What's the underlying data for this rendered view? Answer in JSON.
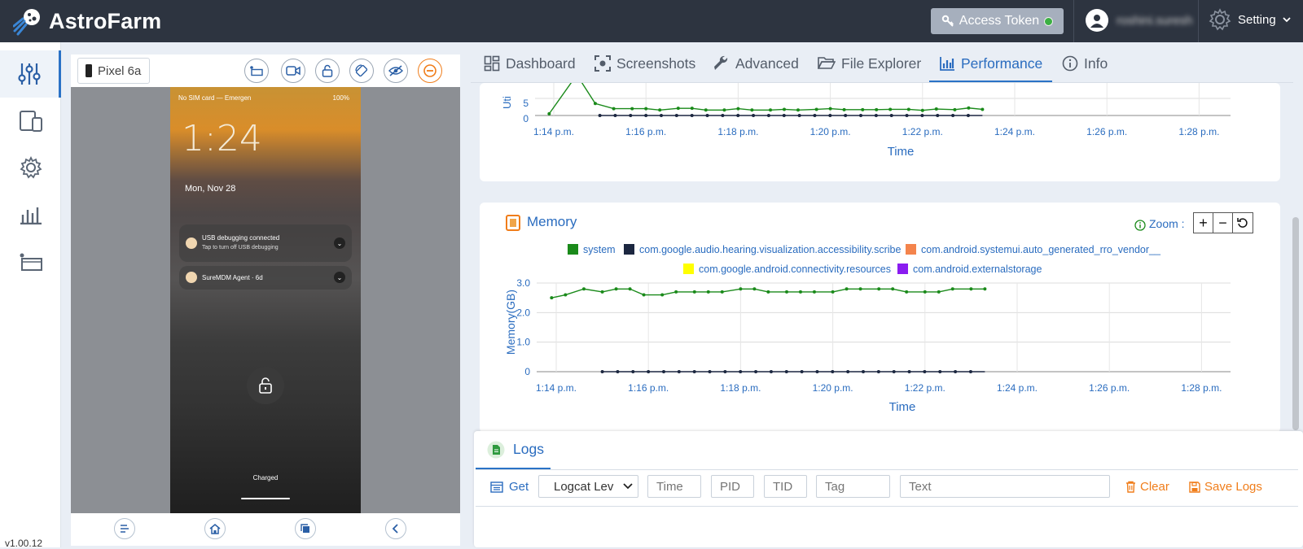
{
  "header": {
    "app_name": "AstroFarm",
    "access_token_label": "Access Token",
    "username": "roshini.suresh",
    "setting_label": "Setting"
  },
  "version": "v1.00.12",
  "device": {
    "name": "Pixel 6a",
    "screen": {
      "status_left": "No SIM card — Emergen",
      "status_right": "100%",
      "clock": "1:24",
      "date": "Mon, Nov 28",
      "notifications": [
        {
          "title": "USB debugging connected",
          "subtitle": "Tap to turn off USB debugging"
        },
        {
          "title": "SureMDM Agent · 6d",
          "subtitle": ""
        }
      ],
      "charged": "Charged"
    }
  },
  "tabs": [
    {
      "label": "Dashboard",
      "icon": "dashboard-icon",
      "active": false
    },
    {
      "label": "Screenshots",
      "icon": "screenshot-icon",
      "active": false
    },
    {
      "label": "Advanced",
      "icon": "wrench-icon",
      "active": false
    },
    {
      "label": "File Explorer",
      "icon": "folder-icon",
      "active": false
    },
    {
      "label": "Performance",
      "icon": "bar-chart-icon",
      "active": true
    },
    {
      "label": "Info",
      "icon": "info-icon",
      "active": false
    }
  ],
  "cpu_chart_partial": {
    "ylabel_fragment": "Uti",
    "xlabel": "Time",
    "x_ticks": [
      "1:14 p.m.",
      "1:16 p.m.",
      "1:18 p.m.",
      "1:20 p.m.",
      "1:22 p.m.",
      "1:24 p.m.",
      "1:26 p.m.",
      "1:28 p.m."
    ],
    "y_ticks": [
      "5",
      "0"
    ]
  },
  "memory_chart": {
    "title": "Memory",
    "zoom_label": "Zoom :",
    "legend": [
      {
        "name": "system",
        "color": "#1a8a1a"
      },
      {
        "name": "com.google.audio.hearing.visualization.accessibility.scribe",
        "color": "#1c2740"
      },
      {
        "name": "com.android.systemui.auto_generated_rro_vendor__",
        "color": "#f4844c"
      },
      {
        "name": "com.google.android.connectivity.resources",
        "color": "#ffff00"
      },
      {
        "name": "com.android.externalstorage",
        "color": "#8a1cf0"
      }
    ]
  },
  "chart_data": [
    {
      "type": "line",
      "title": "",
      "xlabel": "Time",
      "ylabel": "",
      "x_ticks": [
        "1:14 p.m.",
        "1:16 p.m.",
        "1:18 p.m.",
        "1:20 p.m.",
        "1:22 p.m.",
        "1:24 p.m.",
        "1:26 p.m.",
        "1:28 p.m."
      ],
      "ylim": [
        0,
        9
      ],
      "series": [
        {
          "color": "#1a8a1a",
          "x_minutes_after_1_14": [
            -0.1,
            0.5,
            0.9,
            1.3,
            1.7,
            2.0,
            2.3,
            2.7,
            3.0,
            3.3,
            3.7,
            4.0,
            4.3,
            4.7,
            5.0,
            5.3,
            5.7,
            6.0,
            6.3,
            6.7,
            7.0,
            7.3,
            7.7,
            8.0,
            8.3,
            8.7,
            9.0,
            9.3
          ],
          "values": [
            0.5,
            12,
            3.5,
            2,
            2,
            2,
            1.6,
            2.1,
            2.1,
            1.6,
            1.6,
            2,
            1.6,
            1.6,
            1.8,
            1.6,
            1.8,
            2,
            1.7,
            1.7,
            1.7,
            1.8,
            1.8,
            1.5,
            1.9,
            1.7,
            2.2,
            1.8
          ]
        },
        {
          "color": "#1c2740",
          "x_minutes_after_1_14": [
            1.0,
            9.3
          ],
          "values": [
            0,
            0
          ]
        }
      ]
    },
    {
      "type": "line",
      "title": "Memory",
      "xlabel": "Time",
      "ylabel": "Memory(GB)",
      "x_ticks": [
        "1:14 p.m.",
        "1:16 p.m.",
        "1:18 p.m.",
        "1:20 p.m.",
        "1:22 p.m.",
        "1:24 p.m.",
        "1:26 p.m.",
        "1:28 p.m."
      ],
      "y_ticks": [
        "3.0",
        "2.0",
        "1.0",
        "0"
      ],
      "ylim": [
        0,
        3
      ],
      "series": [
        {
          "name": "system",
          "color": "#1a8a1a",
          "x_minutes_after_1_14": [
            -0.1,
            0.2,
            0.6,
            1.0,
            1.3,
            1.6,
            1.9,
            2.3,
            2.6,
            3.0,
            3.3,
            3.6,
            4.0,
            4.3,
            4.6,
            5.0,
            5.3,
            5.6,
            6.0,
            6.3,
            6.6,
            7.0,
            7.3,
            7.6,
            8.0,
            8.3,
            8.6,
            9.0,
            9.3
          ],
          "values": [
            2.5,
            2.6,
            2.8,
            2.7,
            2.8,
            2.8,
            2.6,
            2.6,
            2.7,
            2.7,
            2.7,
            2.7,
            2.8,
            2.8,
            2.7,
            2.7,
            2.7,
            2.7,
            2.7,
            2.8,
            2.8,
            2.8,
            2.8,
            2.7,
            2.7,
            2.7,
            2.8,
            2.8,
            2.8
          ]
        },
        {
          "name": "com.google.audio.hearing.visualization.accessibility.scribe",
          "color": "#1c2740",
          "x_minutes_after_1_14": [
            1.0,
            9.3
          ],
          "values": [
            0,
            0
          ]
        }
      ]
    }
  ],
  "logs": {
    "title": "Logs",
    "get_label": "Get",
    "logcat_level": "Logcat Lev",
    "placeholders": {
      "time": "Time",
      "pid": "PID",
      "tid": "TID",
      "tag": "Tag",
      "text": "Text"
    },
    "clear_label": "Clear",
    "save_label": "Save Logs"
  }
}
